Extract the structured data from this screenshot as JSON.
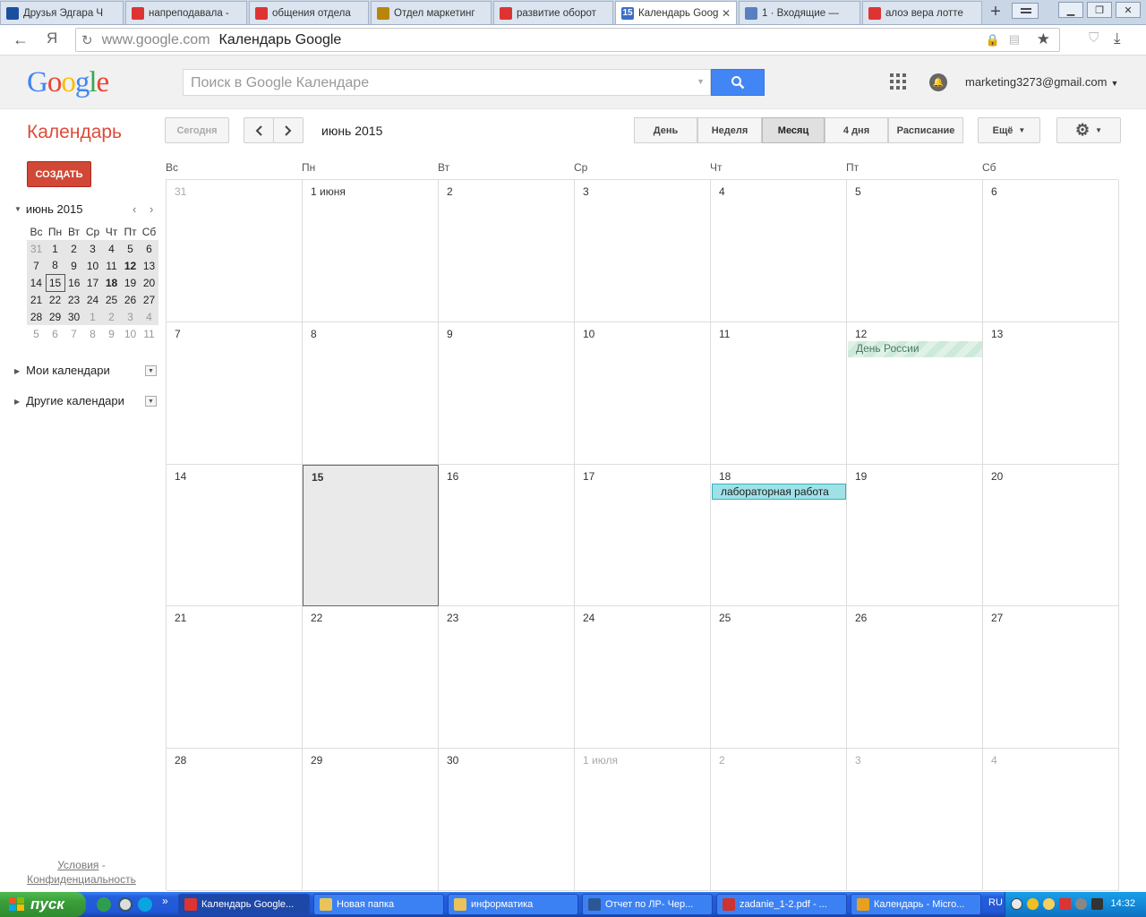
{
  "browser": {
    "tabs": [
      {
        "label": "Друзья Эдгара Ч",
        "fav": "play-icon",
        "color": "#1a4fa0"
      },
      {
        "label": "напреподавала -",
        "fav": "yandex-icon",
        "color": "#d33"
      },
      {
        "label": "общения отдела",
        "fav": "yandex-icon",
        "color": "#d33"
      },
      {
        "label": "Отдел маркетинг",
        "fav": "ga-icon",
        "color": "#b8860b"
      },
      {
        "label": "развитие оборот",
        "fav": "gmail-icon",
        "color": "#d33"
      },
      {
        "label": "Календарь Goog",
        "fav": "calendar-icon",
        "color": "#3b6fc4",
        "fav_text": "15"
      },
      {
        "label": "1 · Входящие —",
        "fav": "mail-icon",
        "color": "#5a7fc0"
      },
      {
        "label": "алоэ вера лотте",
        "fav": "yandex-icon",
        "color": "#d33"
      }
    ],
    "active_close": "✕",
    "new_tab": "+",
    "url_host": "www.google.com",
    "url_title": "Календарь Google",
    "ya_label": "Я"
  },
  "header": {
    "search_placeholder": "Поиск в Google Календаре",
    "account": "marketing3273@gmail.com"
  },
  "toolbar": {
    "app_title": "Календарь",
    "today": "Сегодня",
    "month_label": "июнь 2015",
    "views": [
      "День",
      "Неделя",
      "Месяц",
      "4 дня",
      "Расписание"
    ],
    "selected_view": "Месяц",
    "more": "Ещё"
  },
  "sidebar": {
    "create": "СОЗДАТЬ",
    "mini_title": "июнь 2015",
    "mini_dows": [
      "Вс",
      "Пн",
      "Вт",
      "Ср",
      "Чт",
      "Пт",
      "Сб"
    ],
    "mini_weeks": [
      [
        "31",
        "1",
        "2",
        "3",
        "4",
        "5",
        "6"
      ],
      [
        "7",
        "8",
        "9",
        "10",
        "11",
        "12",
        "13"
      ],
      [
        "14",
        "15",
        "16",
        "17",
        "18",
        "19",
        "20"
      ],
      [
        "21",
        "22",
        "23",
        "24",
        "25",
        "26",
        "27"
      ],
      [
        "28",
        "29",
        "30",
        "1",
        "2",
        "3",
        "4"
      ],
      [
        "5",
        "6",
        "7",
        "8",
        "9",
        "10",
        "11"
      ]
    ],
    "my_calendars": "Мои календари",
    "other_calendars": "Другие календари",
    "terms": "Условия",
    "sep": " -",
    "privacy": "Конфиденциальность"
  },
  "month": {
    "dows": [
      "Вс",
      "Пн",
      "Вт",
      "Ср",
      "Чт",
      "Пт",
      "Сб"
    ],
    "weeks": [
      [
        "31",
        "1 июня",
        "2",
        "3",
        "4",
        "5",
        "6"
      ],
      [
        "7",
        "8",
        "9",
        "10",
        "11",
        "12",
        "13"
      ],
      [
        "14",
        "15",
        "16",
        "17",
        "18",
        "19",
        "20"
      ],
      [
        "21",
        "22",
        "23",
        "24",
        "25",
        "26",
        "27"
      ],
      [
        "28",
        "29",
        "30",
        "1 июля",
        "2",
        "3",
        "4"
      ]
    ],
    "events": [
      {
        "week": 1,
        "day": 5,
        "title": "День России",
        "kind": "holiday"
      },
      {
        "week": 2,
        "day": 4,
        "title": "лабораторная работа",
        "kind": "lab"
      }
    ]
  },
  "taskbar": {
    "start": "пуск",
    "items": [
      {
        "label": "Календарь Google...",
        "color": "#d33"
      },
      {
        "label": "Новая папка",
        "color": "#e8c45a"
      },
      {
        "label": "информатика",
        "color": "#e8c45a"
      },
      {
        "label": "Отчет по ЛР- Чер...",
        "color": "#2b5797"
      },
      {
        "label": "zadanie_1-2.pdf - ...",
        "color": "#c33"
      },
      {
        "label": "Календарь - Micro...",
        "color": "#e8a020"
      }
    ],
    "overflow": "»",
    "lang": "RU",
    "clock": "14:32"
  }
}
